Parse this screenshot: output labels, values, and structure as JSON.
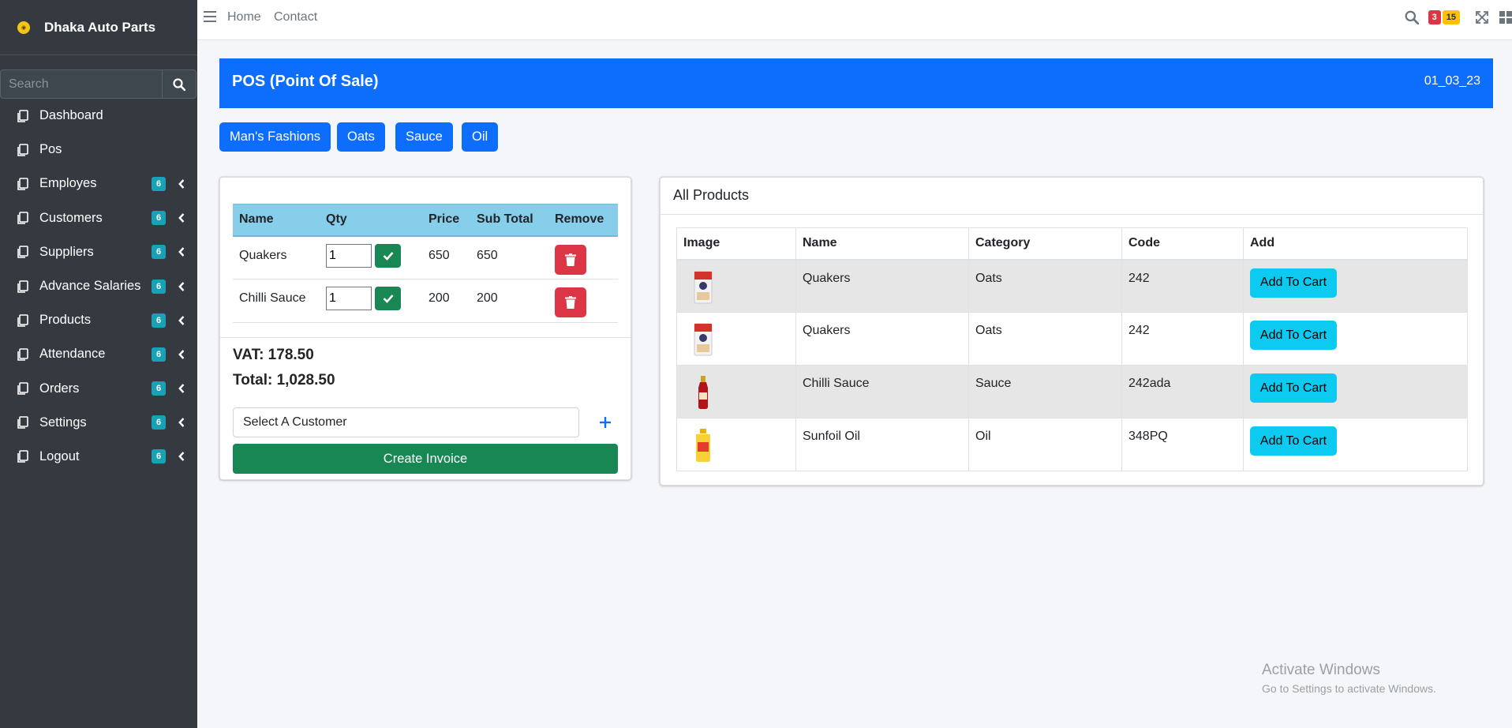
{
  "brand": {
    "name": "Dhaka Auto Parts"
  },
  "sidebar": {
    "search_placeholder": "Search",
    "items": [
      {
        "label": "Dashboard",
        "badge": ""
      },
      {
        "label": "Pos",
        "badge": ""
      },
      {
        "label": "Employes",
        "badge": "6"
      },
      {
        "label": "Customers",
        "badge": "6"
      },
      {
        "label": "Suppliers",
        "badge": "6"
      },
      {
        "label": "Advance Salaries",
        "badge": "6"
      },
      {
        "label": "Products",
        "badge": "6"
      },
      {
        "label": "Attendance",
        "badge": "6"
      },
      {
        "label": "Orders",
        "badge": "6"
      },
      {
        "label": "Settings",
        "badge": "6"
      },
      {
        "label": "Logout",
        "badge": "6"
      }
    ]
  },
  "topbar": {
    "home": "Home",
    "contact": "Contact",
    "notifications_count": "3",
    "messages_count": "15"
  },
  "header": {
    "title": "POS (Point Of Sale)",
    "date": "01_03_23"
  },
  "categories": [
    "Man's Fashions",
    "Oats",
    "Sauce",
    "Oil"
  ],
  "cart": {
    "columns": [
      "Name",
      "Qty",
      "Price",
      "Sub Total",
      "Remove"
    ],
    "rows": [
      {
        "name": "Quakers",
        "qty": "1",
        "price": "650",
        "subtotal": "650"
      },
      {
        "name": "Chilli Sauce",
        "qty": "1",
        "price": "200",
        "subtotal": "200"
      }
    ],
    "vat": "VAT: 178.50",
    "total": "Total: 1,028.50",
    "customer_select": "Select A Customer",
    "create_invoice": "Create Invoice"
  },
  "products": {
    "title": "All Products",
    "columns": [
      "Image",
      "Name",
      "Category",
      "Code",
      "Add"
    ],
    "rows": [
      {
        "image": "quakers-oats-icon",
        "name": "Quakers",
        "category": "Oats",
        "code": "242",
        "add": "Add To Cart"
      },
      {
        "image": "quakers-oats-icon",
        "name": "Quakers",
        "category": "Oats",
        "code": "242",
        "add": "Add To Cart"
      },
      {
        "image": "chilli-sauce-bottle-icon",
        "name": "Chilli Sauce",
        "category": "Sauce",
        "code": "242ada",
        "add": "Add To Cart"
      },
      {
        "image": "sunfoil-oil-bottle-icon",
        "name": "Sunfoil Oil",
        "category": "Oil",
        "code": "348PQ",
        "add": "Add To Cart"
      }
    ]
  },
  "watermark": {
    "line1": "Activate Windows",
    "line2": "Go to Settings to activate Windows."
  },
  "colors": {
    "primary": "#0d6efd",
    "success": "#198754",
    "danger": "#dc3545",
    "info": "#0dcaf0",
    "sidebar": "#343a40",
    "cart_header": "#87ceeb"
  }
}
